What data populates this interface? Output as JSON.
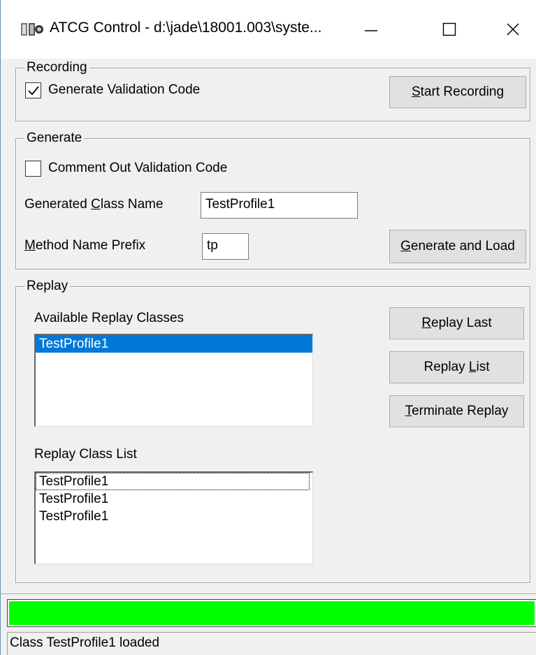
{
  "window": {
    "title": "ATCG Control - d:\\jade\\18001.003\\syste...",
    "app_icon": "3d-app-icon"
  },
  "recording": {
    "group_label": "Recording",
    "generate_validation_label": "Generate Validation Code",
    "generate_validation_checked": true,
    "start_button_underlined": "S",
    "start_button_rest": "tart Recording"
  },
  "generate": {
    "group_label": "Generate",
    "comment_out_label": "Comment Out Validation Code",
    "comment_out_checked": false,
    "class_name_label_pre": "Generated ",
    "class_name_label_ul": "C",
    "class_name_label_post": "lass Name",
    "class_name_value": "TestProfile1",
    "prefix_label_ul": "M",
    "prefix_label_post": "ethod Name Prefix",
    "prefix_value": "tp",
    "generate_button_ul": "G",
    "generate_button_rest": "enerate and Load"
  },
  "replay": {
    "group_label": "Replay",
    "available_label": "Available Replay Classes",
    "available_items": [
      "TestProfile1"
    ],
    "class_list_label": "Replay Class List",
    "class_list_items": [
      "TestProfile1",
      "TestProfile1",
      "TestProfile1"
    ],
    "replay_last_ul": "R",
    "replay_last_rest": "eplay Last",
    "replay_list_pre": "Replay ",
    "replay_list_ul": "L",
    "replay_list_post": "ist",
    "terminate_ul": "T",
    "terminate_rest": "erminate Replay"
  },
  "progress": {
    "fraction": 1.0,
    "color": "#00ff00"
  },
  "status": {
    "text": "Class TestProfile1 loaded"
  },
  "colors": {
    "selection": "#0078d7",
    "face": "#f0f0f0"
  }
}
